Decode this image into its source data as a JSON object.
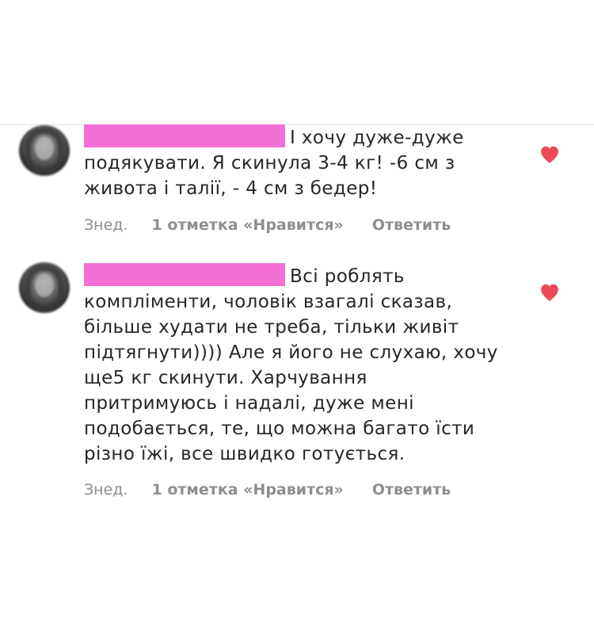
{
  "comments": [
    {
      "text": "І хочу дуже-дуже подякувати. Я скинула 3-4 кг! -6 см з живота і талії, - 4 см з бедер!",
      "time": "Знед.",
      "likes": "1 отметка «Нравится»",
      "reply": "Ответить",
      "liked_icon": "heart-icon"
    },
    {
      "text": "Всі роблять компліменти, чоловік взагалі сказав, більше худати не треба, тільки живіт підтягнути)))) Але я його не слухаю, хочу ще5 кг скинути. Харчування притримуюсь і надалі, дуже мені подобається, те, що можна багато їсти різно їжі, все швидко готується.",
      "time": "Знед.",
      "likes": "1 отметка «Нравится»",
      "reply": "Ответить",
      "liked_icon": "heart-icon"
    }
  ],
  "colors": {
    "text": "#262626",
    "meta": "#8e8e8e",
    "heart": "#ed4956",
    "redaction": "#f36fd3"
  }
}
